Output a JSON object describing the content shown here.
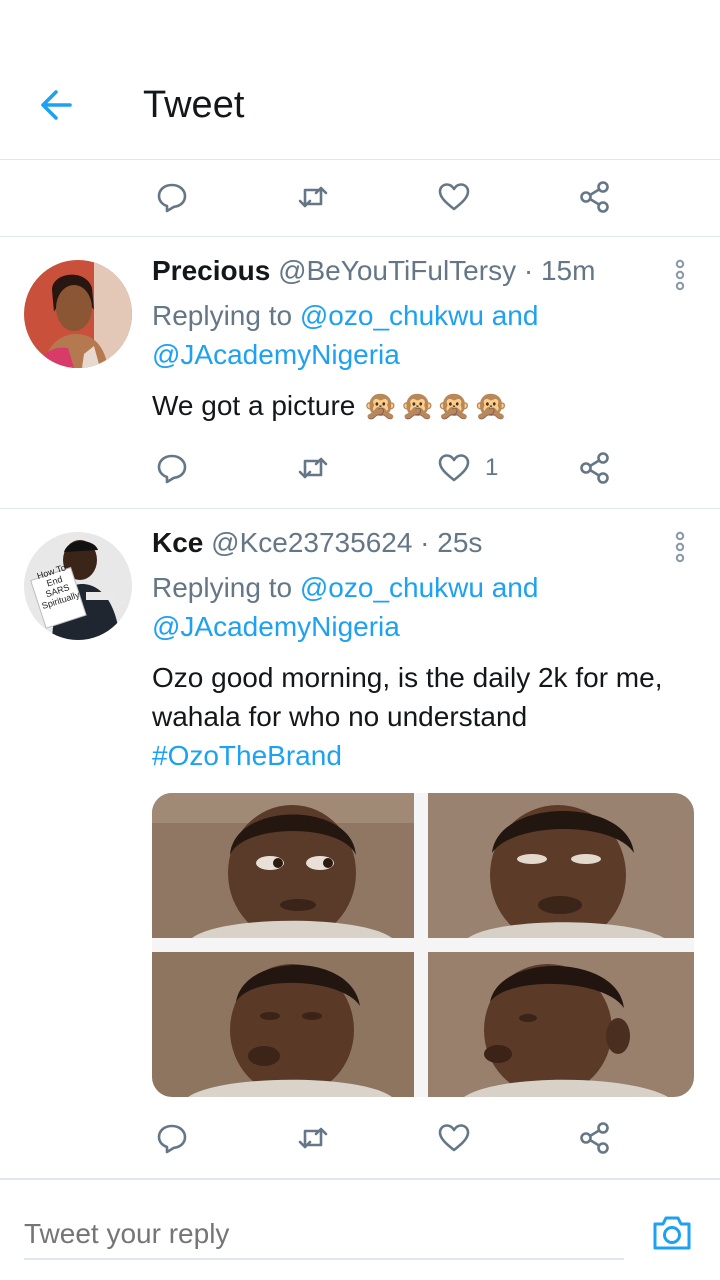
{
  "header": {
    "title": "Tweet"
  },
  "actions_top": {
    "like_count": ""
  },
  "tweets": [
    {
      "name": "Precious",
      "handle": "@BeYouTiFulTersy",
      "time": " · 15m",
      "replying_prefix": "Replying to ",
      "reply_user1": "@ozo_chukwu",
      "reply_and": " and",
      "reply_user2": "@JAcademyNigeria",
      "text": "We got a picture",
      "emoji": "🙊🙊🙊🙊",
      "like_count": "1"
    },
    {
      "name": "Kce",
      "handle": "@Kce23735624",
      "time": " · 25s",
      "replying_prefix": "Replying to ",
      "reply_user1": "@ozo_chukwu",
      "reply_and": " and",
      "reply_user2": "@JAcademyNigeria",
      "text_line1": "Ozo good morning, is the daily 2k for me,",
      "text_line2": "wahala for who no understand",
      "hashtag": "#OzoTheBrand",
      "avatar_sign_text": "How To End SARS Spiritually",
      "like_count": ""
    }
  ],
  "reply_bar": {
    "placeholder": "Tweet your reply"
  },
  "colors": {
    "accent": "#1da1f2",
    "muted": "#657786",
    "divider": "#e1e8ed"
  }
}
